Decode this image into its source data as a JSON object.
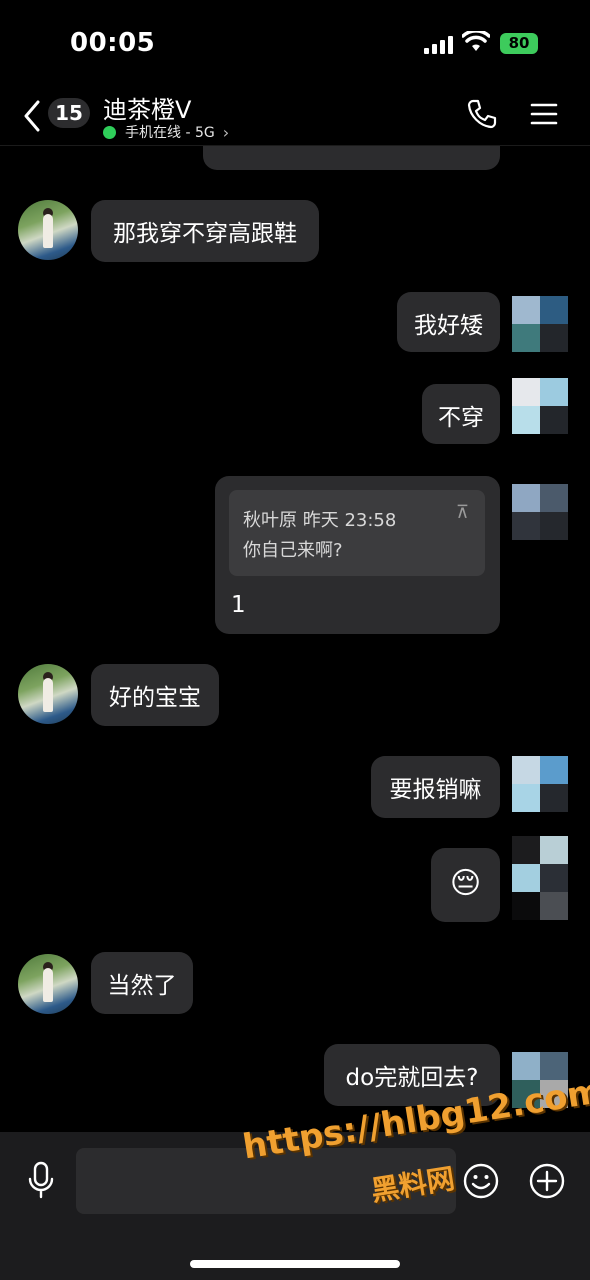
{
  "status_bar": {
    "time": "00:05",
    "battery": "80"
  },
  "header": {
    "unread_count": "15",
    "contact_name": "迪茶橙V",
    "online_status": "手机在线 - 5G"
  },
  "messages": [
    {
      "side": "left",
      "text": "那我穿不穿高跟鞋"
    },
    {
      "side": "right",
      "text": "我好矮"
    },
    {
      "side": "right",
      "text": "不穿"
    },
    {
      "side": "right",
      "quote_author_time": "秋叶原 昨天 23:58",
      "quote_text": "你自己来啊?",
      "text": "1"
    },
    {
      "side": "left",
      "text": "好的宝宝"
    },
    {
      "side": "right",
      "text": "要报销嘛"
    },
    {
      "side": "right",
      "text": "😔"
    },
    {
      "side": "left",
      "text": "当然了"
    },
    {
      "side": "right",
      "text": "do完就回去?"
    }
  ],
  "watermark": {
    "url": "https://hlbg12.com",
    "name": "黑料网"
  },
  "colors": {
    "bubble": "#2c2c2e",
    "online": "#2fce5a",
    "battery": "#3dcb5c",
    "watermark": "#f0a030"
  }
}
